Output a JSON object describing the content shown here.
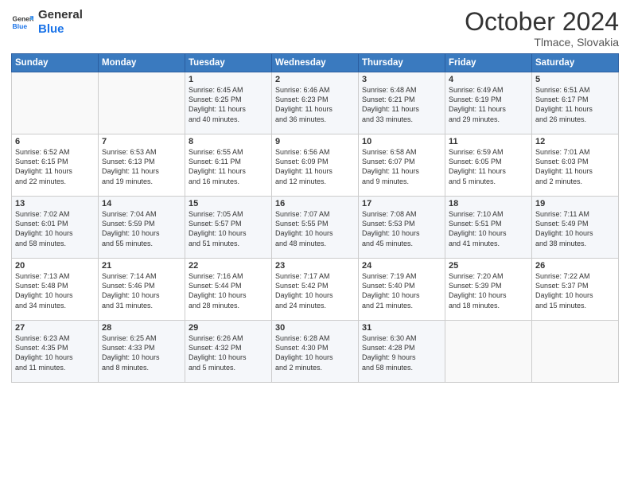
{
  "header": {
    "logo_line1": "General",
    "logo_line2": "Blue",
    "month_title": "October 2024",
    "location": "Tlmace, Slovakia"
  },
  "weekdays": [
    "Sunday",
    "Monday",
    "Tuesday",
    "Wednesday",
    "Thursday",
    "Friday",
    "Saturday"
  ],
  "weeks": [
    [
      {
        "day": "",
        "detail": ""
      },
      {
        "day": "",
        "detail": ""
      },
      {
        "day": "1",
        "detail": "Sunrise: 6:45 AM\nSunset: 6:25 PM\nDaylight: 11 hours\nand 40 minutes."
      },
      {
        "day": "2",
        "detail": "Sunrise: 6:46 AM\nSunset: 6:23 PM\nDaylight: 11 hours\nand 36 minutes."
      },
      {
        "day": "3",
        "detail": "Sunrise: 6:48 AM\nSunset: 6:21 PM\nDaylight: 11 hours\nand 33 minutes."
      },
      {
        "day": "4",
        "detail": "Sunrise: 6:49 AM\nSunset: 6:19 PM\nDaylight: 11 hours\nand 29 minutes."
      },
      {
        "day": "5",
        "detail": "Sunrise: 6:51 AM\nSunset: 6:17 PM\nDaylight: 11 hours\nand 26 minutes."
      }
    ],
    [
      {
        "day": "6",
        "detail": "Sunrise: 6:52 AM\nSunset: 6:15 PM\nDaylight: 11 hours\nand 22 minutes."
      },
      {
        "day": "7",
        "detail": "Sunrise: 6:53 AM\nSunset: 6:13 PM\nDaylight: 11 hours\nand 19 minutes."
      },
      {
        "day": "8",
        "detail": "Sunrise: 6:55 AM\nSunset: 6:11 PM\nDaylight: 11 hours\nand 16 minutes."
      },
      {
        "day": "9",
        "detail": "Sunrise: 6:56 AM\nSunset: 6:09 PM\nDaylight: 11 hours\nand 12 minutes."
      },
      {
        "day": "10",
        "detail": "Sunrise: 6:58 AM\nSunset: 6:07 PM\nDaylight: 11 hours\nand 9 minutes."
      },
      {
        "day": "11",
        "detail": "Sunrise: 6:59 AM\nSunset: 6:05 PM\nDaylight: 11 hours\nand 5 minutes."
      },
      {
        "day": "12",
        "detail": "Sunrise: 7:01 AM\nSunset: 6:03 PM\nDaylight: 11 hours\nand 2 minutes."
      }
    ],
    [
      {
        "day": "13",
        "detail": "Sunrise: 7:02 AM\nSunset: 6:01 PM\nDaylight: 10 hours\nand 58 minutes."
      },
      {
        "day": "14",
        "detail": "Sunrise: 7:04 AM\nSunset: 5:59 PM\nDaylight: 10 hours\nand 55 minutes."
      },
      {
        "day": "15",
        "detail": "Sunrise: 7:05 AM\nSunset: 5:57 PM\nDaylight: 10 hours\nand 51 minutes."
      },
      {
        "day": "16",
        "detail": "Sunrise: 7:07 AM\nSunset: 5:55 PM\nDaylight: 10 hours\nand 48 minutes."
      },
      {
        "day": "17",
        "detail": "Sunrise: 7:08 AM\nSunset: 5:53 PM\nDaylight: 10 hours\nand 45 minutes."
      },
      {
        "day": "18",
        "detail": "Sunrise: 7:10 AM\nSunset: 5:51 PM\nDaylight: 10 hours\nand 41 minutes."
      },
      {
        "day": "19",
        "detail": "Sunrise: 7:11 AM\nSunset: 5:49 PM\nDaylight: 10 hours\nand 38 minutes."
      }
    ],
    [
      {
        "day": "20",
        "detail": "Sunrise: 7:13 AM\nSunset: 5:48 PM\nDaylight: 10 hours\nand 34 minutes."
      },
      {
        "day": "21",
        "detail": "Sunrise: 7:14 AM\nSunset: 5:46 PM\nDaylight: 10 hours\nand 31 minutes."
      },
      {
        "day": "22",
        "detail": "Sunrise: 7:16 AM\nSunset: 5:44 PM\nDaylight: 10 hours\nand 28 minutes."
      },
      {
        "day": "23",
        "detail": "Sunrise: 7:17 AM\nSunset: 5:42 PM\nDaylight: 10 hours\nand 24 minutes."
      },
      {
        "day": "24",
        "detail": "Sunrise: 7:19 AM\nSunset: 5:40 PM\nDaylight: 10 hours\nand 21 minutes."
      },
      {
        "day": "25",
        "detail": "Sunrise: 7:20 AM\nSunset: 5:39 PM\nDaylight: 10 hours\nand 18 minutes."
      },
      {
        "day": "26",
        "detail": "Sunrise: 7:22 AM\nSunset: 5:37 PM\nDaylight: 10 hours\nand 15 minutes."
      }
    ],
    [
      {
        "day": "27",
        "detail": "Sunrise: 6:23 AM\nSunset: 4:35 PM\nDaylight: 10 hours\nand 11 minutes."
      },
      {
        "day": "28",
        "detail": "Sunrise: 6:25 AM\nSunset: 4:33 PM\nDaylight: 10 hours\nand 8 minutes."
      },
      {
        "day": "29",
        "detail": "Sunrise: 6:26 AM\nSunset: 4:32 PM\nDaylight: 10 hours\nand 5 minutes."
      },
      {
        "day": "30",
        "detail": "Sunrise: 6:28 AM\nSunset: 4:30 PM\nDaylight: 10 hours\nand 2 minutes."
      },
      {
        "day": "31",
        "detail": "Sunrise: 6:30 AM\nSunset: 4:28 PM\nDaylight: 9 hours\nand 58 minutes."
      },
      {
        "day": "",
        "detail": ""
      },
      {
        "day": "",
        "detail": ""
      }
    ]
  ]
}
